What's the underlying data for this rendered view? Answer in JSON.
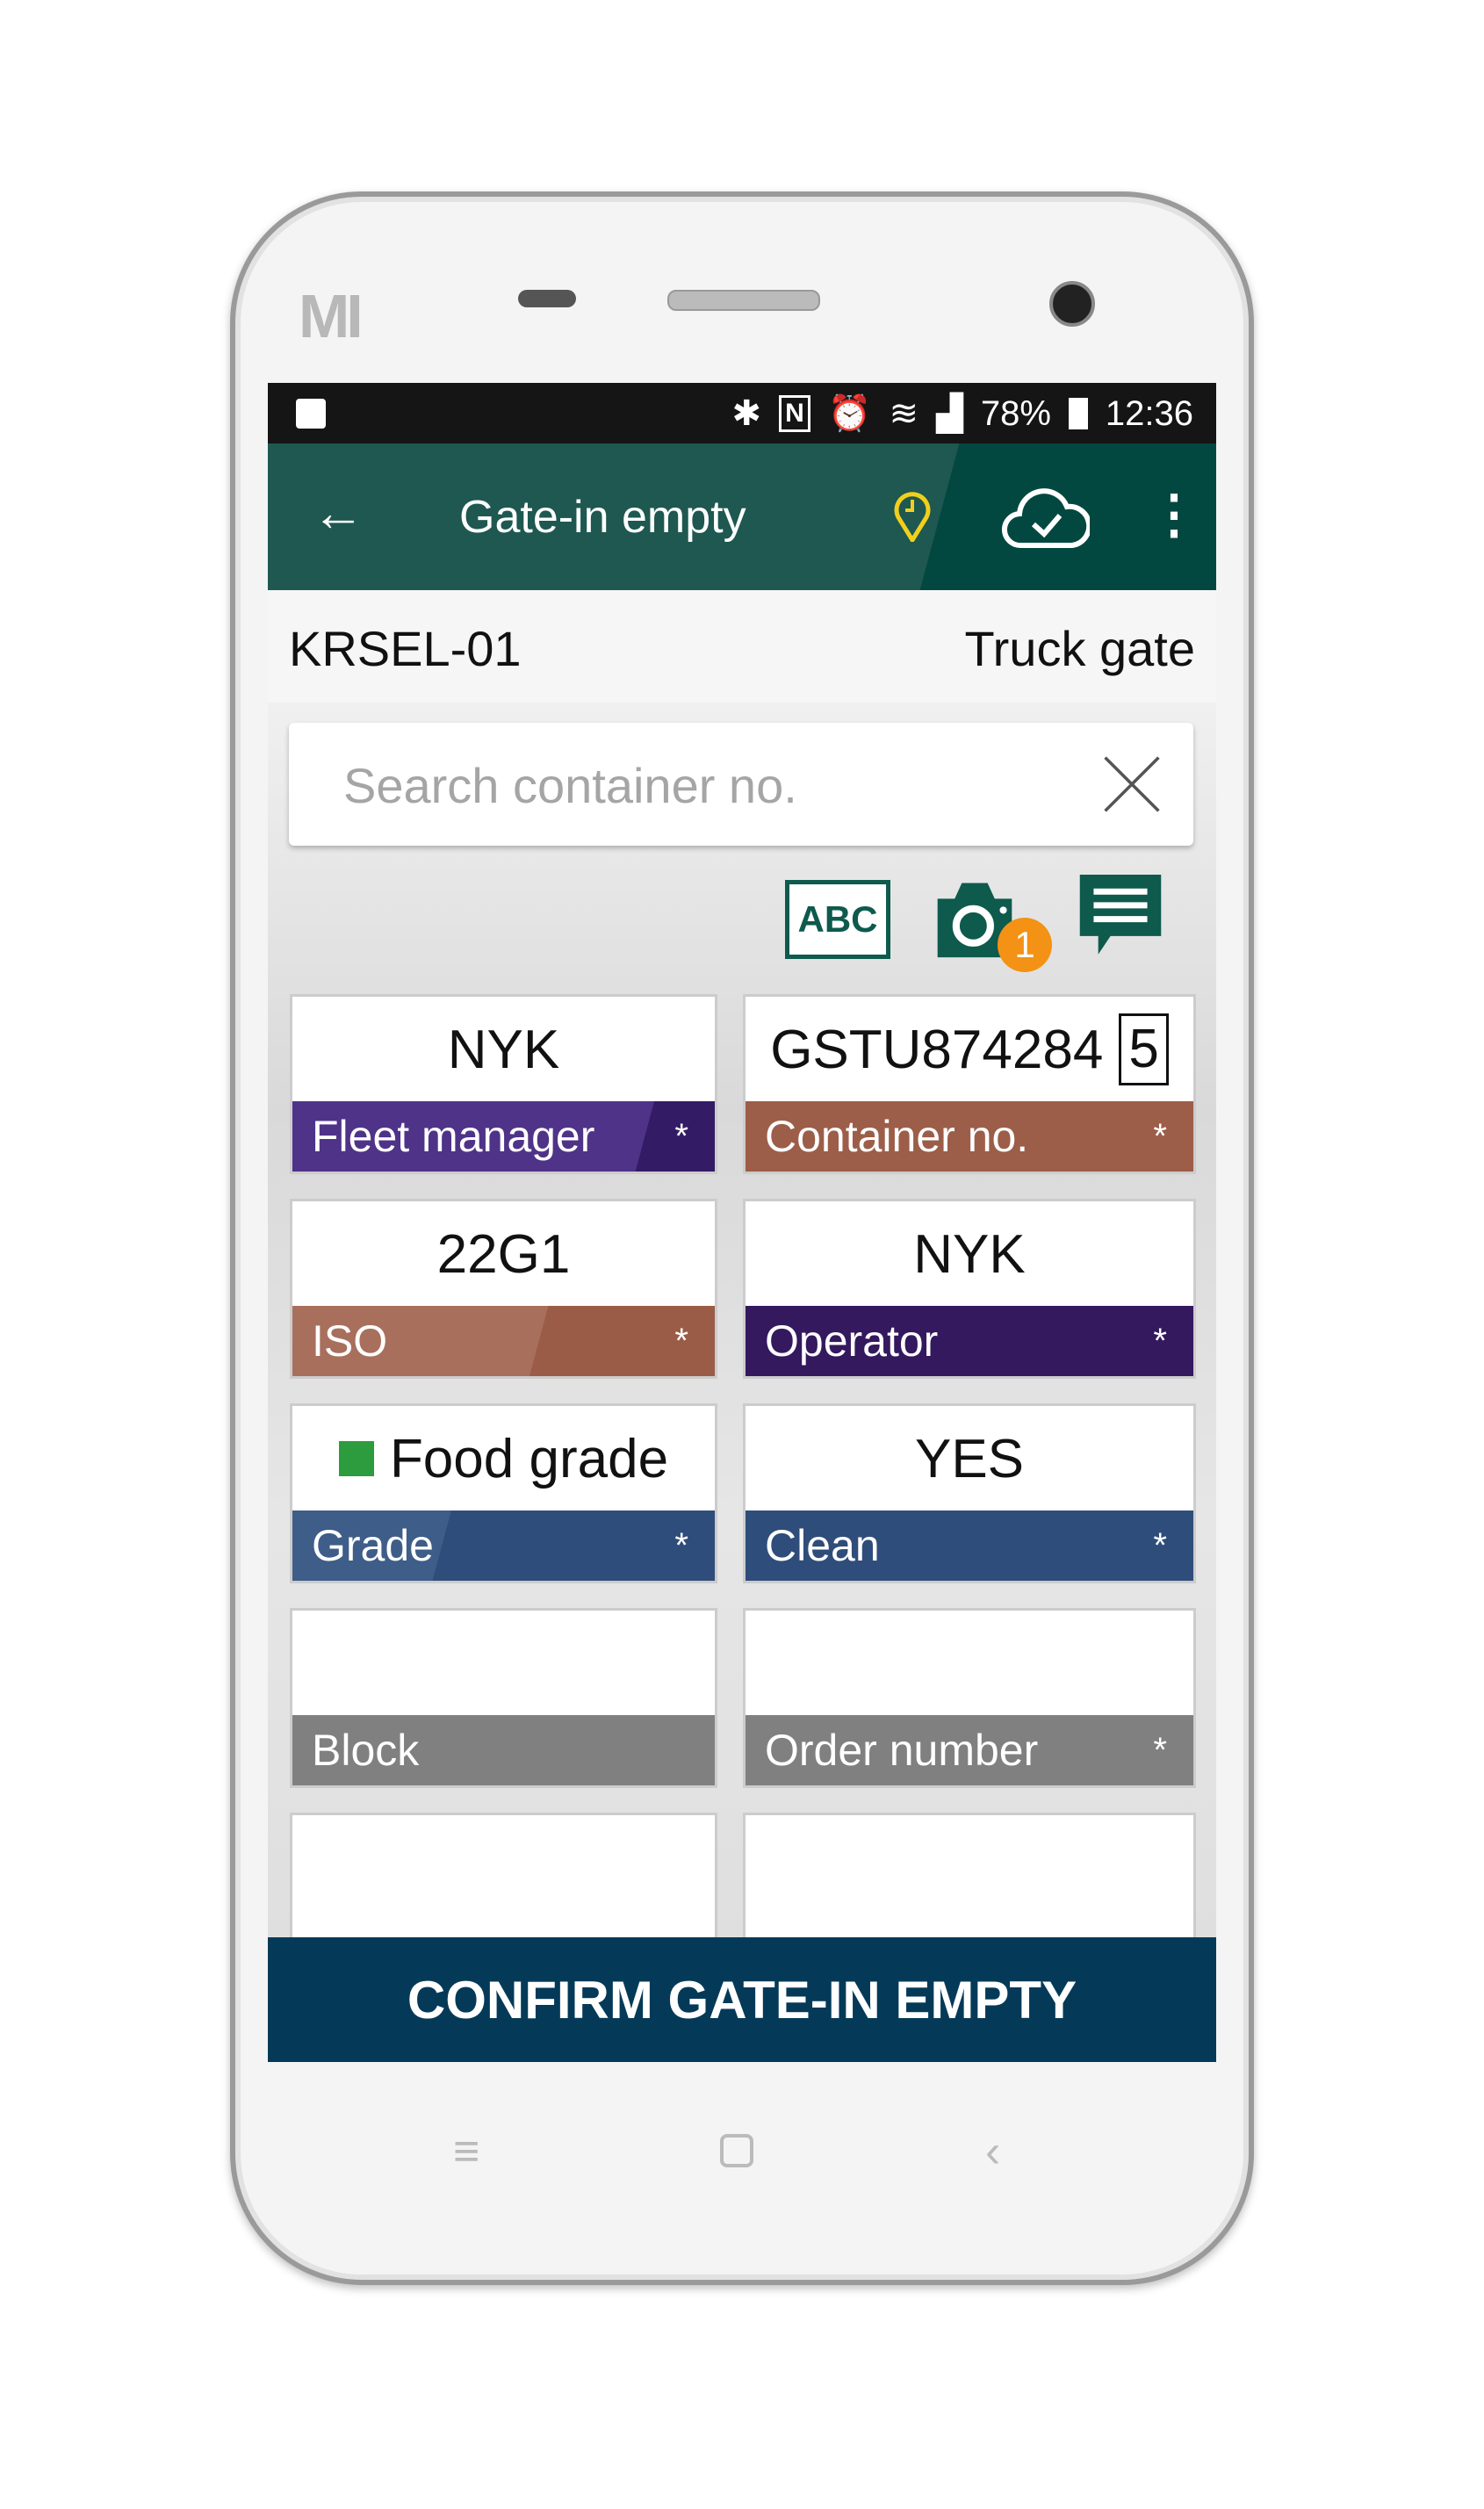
{
  "device": {
    "brand_logo": "MI"
  },
  "status_bar": {
    "battery": "78%",
    "time": "12:36",
    "icons": [
      "gallery-icon",
      "bluetooth-icon",
      "nfc-icon",
      "alarm-icon",
      "wifi-icon",
      "signal-icon",
      "battery-icon"
    ]
  },
  "toolbar": {
    "title": "Gate-in empty",
    "back_icon": "arrow-left-icon",
    "location_icon": "location-clock-icon",
    "sync_icon": "cloud-check-icon",
    "menu_icon": "more-vert-icon",
    "location_color": "#f2cf1c"
  },
  "info": {
    "location": "KRSEL-01",
    "gate": "Truck gate"
  },
  "search": {
    "placeholder": "Search container no.",
    "value": ""
  },
  "actions": {
    "ocr_label": "ABC",
    "photo_count": "1"
  },
  "fields": [
    {
      "value": "NYK",
      "label": "Fleet manager",
      "required": "*",
      "color": "#4a2d80"
    },
    {
      "value": "GSTU874284",
      "check_digit": "5",
      "label": "Container no.",
      "required": "*",
      "color": "#9c5e48"
    },
    {
      "value": "22G1",
      "label": "ISO",
      "required": "*",
      "color": "#9c5e48"
    },
    {
      "value": "NYK",
      "label": "Operator",
      "required": "*",
      "color": "#34195e"
    },
    {
      "value": "Food grade",
      "label": "Grade",
      "required": "*",
      "color": "#2f4d7a",
      "indicator_color": "#2c9c3e"
    },
    {
      "value": "YES",
      "label": "Clean",
      "required": "*",
      "color": "#2f4d7a"
    },
    {
      "value": "",
      "label": "Block",
      "required": "",
      "color": "#808080"
    },
    {
      "value": "",
      "label": "Order number",
      "required": "*",
      "color": "#808080"
    }
  ],
  "confirm": {
    "label": "CONFIRM GATE-IN EMPTY",
    "color": "#043a58"
  },
  "brand_colors": {
    "primary": "#1e5850",
    "accent": "#f39214"
  }
}
